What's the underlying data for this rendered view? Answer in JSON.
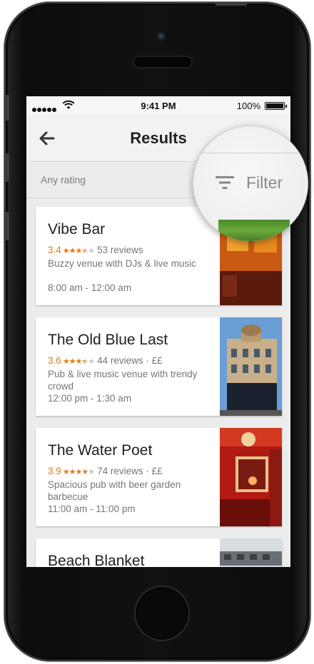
{
  "status_bar": {
    "time": "9:41 PM",
    "battery": "100%"
  },
  "header": {
    "title": "Results"
  },
  "filter_bar": {
    "rating_filter": "Any rating",
    "filter_label": "Filter"
  },
  "results": [
    {
      "name": "Vibe Bar",
      "rating": "3.4",
      "stars": 3.4,
      "reviews": "53 reviews",
      "price": "",
      "description": "Buzzy venue with DJs & live music",
      "hours": "8:00 am - 12:00 am"
    },
    {
      "name": "The Old Blue Last",
      "rating": "3.6",
      "stars": 3.6,
      "reviews": "44 reviews",
      "price": "££",
      "description": "Pub & live music venue with trendy crowd",
      "hours": "12:00 pm - 1:30 am"
    },
    {
      "name": "The Water Poet",
      "rating": "3.9",
      "stars": 3.9,
      "reviews": "74 reviews",
      "price": "££",
      "description": "Spacious pub with beer garden barbecue",
      "hours": "11:00 am - 11:00 pm"
    },
    {
      "name": "Beach Blanket",
      "rating": "",
      "stars": 0,
      "reviews": "",
      "price": "",
      "description": "",
      "hours": ""
    }
  ],
  "colors": {
    "rating_accent": "#e07b1c",
    "secondary_text": "#777777"
  },
  "icons": [
    "back-arrow-icon",
    "filter-icon",
    "wifi-icon",
    "battery-icon",
    "signal-icon"
  ]
}
